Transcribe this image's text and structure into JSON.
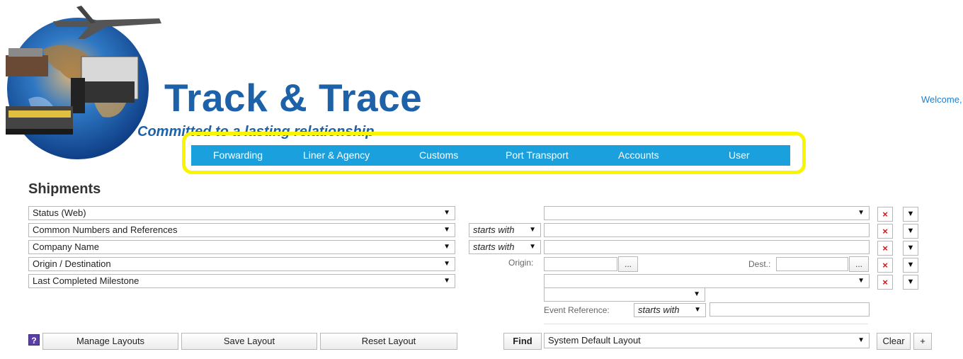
{
  "header": {
    "title": "Track & Trace",
    "tagline": "Committed to a lasting relationship",
    "welcome": "Welcome,"
  },
  "nav": {
    "items": [
      "Forwarding",
      "Liner & Agency",
      "Customs",
      "Port Transport",
      "Accounts",
      "User"
    ]
  },
  "page": {
    "heading": "Shipments"
  },
  "filters": {
    "fields": [
      "Status (Web)",
      "Common Numbers and References",
      "Company Name",
      "Origin / Destination",
      "Last Completed Milestone"
    ],
    "operator_common": "starts with",
    "operator_company": "starts with",
    "origin_label": "Origin:",
    "dest_label": "Dest.:",
    "ellipsis": "...",
    "event_reference_label": "Event Reference:",
    "event_operator": "starts with",
    "remove_symbol": "×",
    "dropdown_symbol": "▼"
  },
  "toolbar": {
    "help_symbol": "?",
    "manage_layouts": "Manage Layouts",
    "save_layout": "Save Layout",
    "reset_layout": "Reset Layout",
    "find": "Find",
    "layout_select": "System Default Layout",
    "clear": "Clear",
    "add": "+"
  },
  "colors": {
    "brand_blue": "#1d62a8",
    "nav_bg": "#1aa0dc",
    "highlight": "#f9f500",
    "remove_red": "#e01010"
  },
  "icons": [
    "globe-logo-icon",
    "help-icon",
    "remove-icon",
    "chevron-down-icon"
  ]
}
